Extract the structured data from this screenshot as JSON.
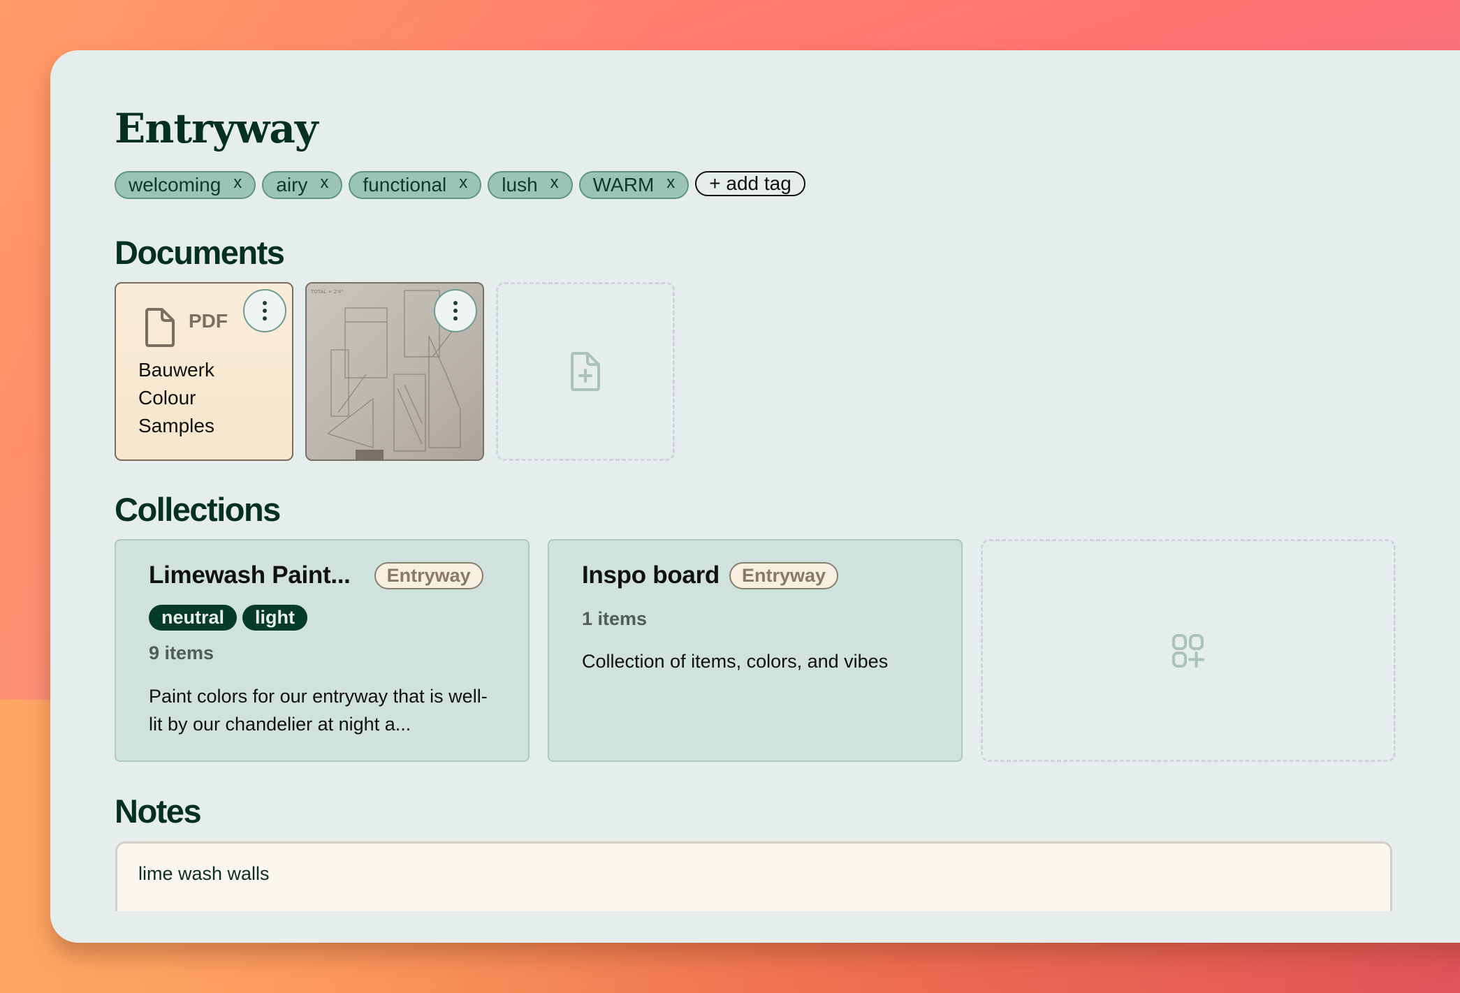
{
  "page": {
    "title": "Entryway",
    "tags": [
      {
        "label": "welcoming",
        "remove": "x"
      },
      {
        "label": "airy",
        "remove": "x"
      },
      {
        "label": "functional",
        "remove": "x"
      },
      {
        "label": "lush",
        "remove": "x"
      },
      {
        "label": "WARM",
        "remove": "x"
      }
    ],
    "add_tag_label": "+ add tag"
  },
  "documents": {
    "heading": "Documents",
    "items": [
      {
        "type": "PDF",
        "name": "Bauwerk Colour Samples",
        "icon": "file-icon",
        "menu_icon": "more-vertical-icon"
      },
      {
        "type": "image",
        "name": "hand-drawn sketch",
        "menu_icon": "more-vertical-icon"
      }
    ],
    "add_icon": "file-plus-icon"
  },
  "collections": {
    "heading": "Collections",
    "items": [
      {
        "title": "Limewash Paint...",
        "room": "Entryway",
        "tags": [
          "neutral",
          "light"
        ],
        "count": "9 items",
        "description": "Paint colors for our entryway that is well-lit by our chandelier at night a..."
      },
      {
        "title": "Inspo board",
        "room": "Entryway",
        "tags": [],
        "count": "1 items",
        "description": "Collection of items, colors, and vibes"
      }
    ],
    "add_icon": "add-collection-icon"
  },
  "notes": {
    "heading": "Notes",
    "text": "lime wash walls"
  },
  "colors": {
    "primary_dark": "#04301f",
    "tag_bg": "#9cc3b7",
    "tag_border": "#5f9482",
    "card_bg": "#cfe2de",
    "window_bg": "#e5eeed",
    "room_badge_bg": "#f8efe1",
    "pdf_card_bg": "#f7e9d3",
    "notes_bg": "#faf6f0"
  }
}
